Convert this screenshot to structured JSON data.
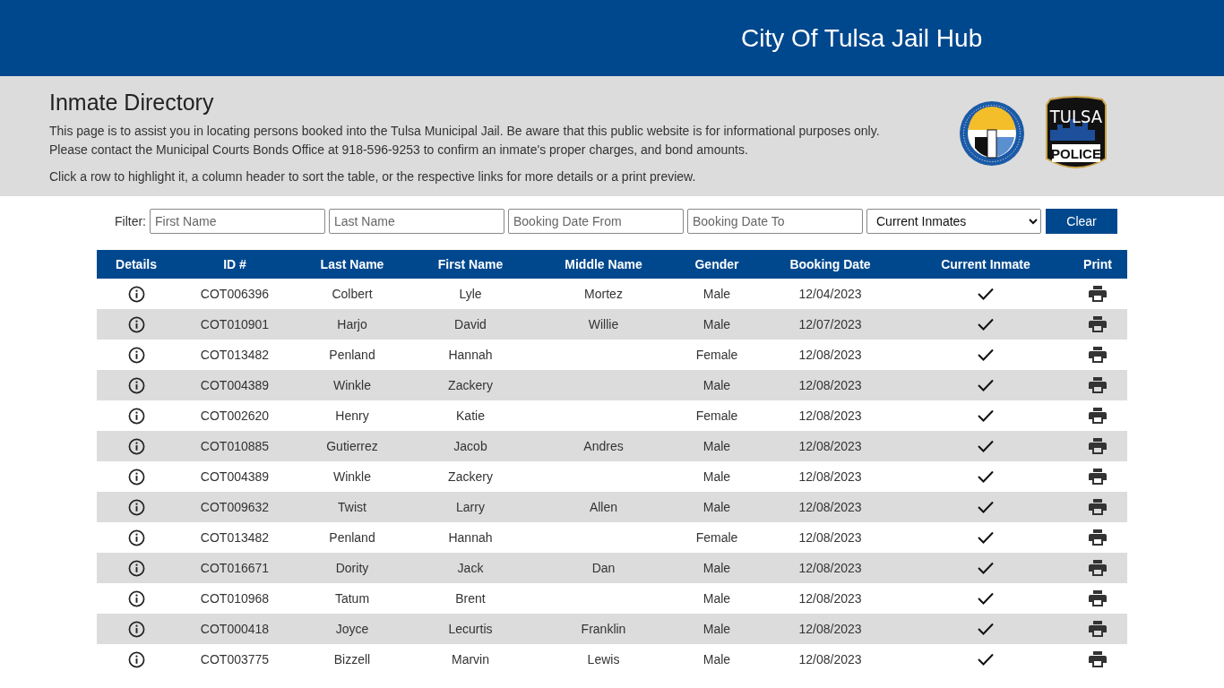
{
  "header": {
    "title": "City Of Tulsa Jail Hub"
  },
  "intro": {
    "heading": "Inmate Directory",
    "paragraphs": [
      "This page is to assist you in locating persons booked into the Tulsa Municipal Jail. Be aware that this public website is for informational purposes only. Please contact the Municipal Courts Bonds Office at 918-596-9253 to confirm an inmate's proper charges, and bond amounts.",
      "Click a row to highlight it, a column header to sort the table, or the respective links for more details or a print preview."
    ],
    "badge_top": "TULSA",
    "badge_bottom": "POLICE"
  },
  "filter": {
    "label": "Filter:",
    "fields": [
      {
        "placeholder": "First Name"
      },
      {
        "placeholder": "Last Name"
      },
      {
        "placeholder": "Booking Date From"
      },
      {
        "placeholder": "Booking Date To"
      }
    ],
    "select": "Current Inmates",
    "button": "Clear"
  },
  "table": {
    "columns": [
      "Details",
      "ID #",
      "Last Name",
      "First Name",
      "Middle Name",
      "Gender",
      "Booking Date",
      "Current Inmate",
      "Print"
    ],
    "rows": [
      {
        "id": "COT006396",
        "last": "Colbert",
        "first": "Lyle",
        "middle": "Mortez",
        "gender": "Male",
        "date": "12/04/2023",
        "current": true
      },
      {
        "id": "COT010901",
        "last": "Harjo",
        "first": "David",
        "middle": "Willie",
        "gender": "Male",
        "date": "12/07/2023",
        "current": true
      },
      {
        "id": "COT013482",
        "last": "Penland",
        "first": "Hannah",
        "gender": "Female",
        "date": "12/08/2023",
        "current": true
      },
      {
        "id": "COT004389",
        "last": "Winkle",
        "first": "Zackery",
        "gender": "Male",
        "date": "12/08/2023",
        "current": true
      },
      {
        "id": "COT002620",
        "last": "Henry",
        "first": "Katie",
        "gender": "Female",
        "date": "12/08/2023",
        "current": true
      },
      {
        "id": "COT010885",
        "last": "Gutierrez",
        "first": "Jacob",
        "middle": "Andres",
        "gender": "Male",
        "date": "12/08/2023",
        "current": true
      },
      {
        "id": "COT004389",
        "last": "Winkle",
        "first": "Zackery",
        "gender": "Male",
        "date": "12/08/2023",
        "current": true
      },
      {
        "id": "COT009632",
        "last": "Twist",
        "first": "Larry",
        "middle": "Allen",
        "gender": "Male",
        "date": "12/08/2023",
        "current": true
      },
      {
        "id": "COT013482",
        "last": "Penland",
        "first": "Hannah",
        "gender": "Female",
        "date": "12/08/2023",
        "current": true
      },
      {
        "id": "COT016671",
        "last": "Dority",
        "first": "Jack",
        "middle": "Dan",
        "gender": "Male",
        "date": "12/08/2023",
        "current": true
      },
      {
        "id": "COT010968",
        "last": "Tatum",
        "first": "Brent",
        "gender": "Male",
        "date": "12/08/2023",
        "current": true
      },
      {
        "id": "COT000418",
        "last": "Joyce",
        "first": "Lecurtis",
        "middle": "Franklin",
        "gender": "Male",
        "date": "12/08/2023",
        "current": true
      },
      {
        "id": "COT003775",
        "last": "Bizzell",
        "first": "Marvin",
        "middle": "Lewis",
        "gender": "Male",
        "date": "12/08/2023",
        "current": true
      }
    ]
  }
}
